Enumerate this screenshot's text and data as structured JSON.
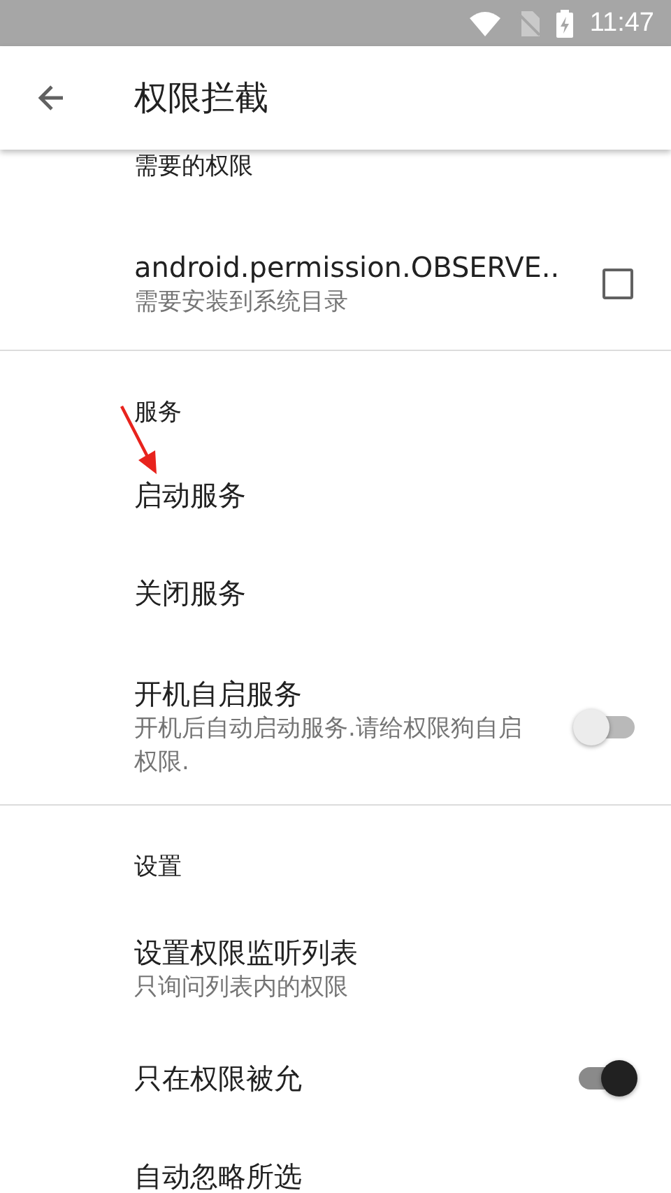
{
  "status_bar": {
    "time": "11:47"
  },
  "toolbar": {
    "title": "权限拦截"
  },
  "sections": [
    {
      "header": "需要的权限",
      "items": [
        {
          "kind": "checkbox",
          "title": "android.permission.OBSERVE..",
          "summary": "需要安装到系统目录",
          "checked": false
        }
      ]
    },
    {
      "header": "服务",
      "items": [
        {
          "kind": "plain",
          "title": "启动服务"
        },
        {
          "kind": "plain",
          "title": "关闭服务"
        },
        {
          "kind": "switch",
          "title": "开机自启服务",
          "summary": "开机后自动启动服务.请给权限狗自启权限.",
          "on": false
        }
      ]
    },
    {
      "header": "设置",
      "items": [
        {
          "kind": "plain",
          "title": "设置权限监听列表",
          "summary": "只询问列表内的权限"
        },
        {
          "kind": "switch",
          "title": "只在权限被允",
          "on": true
        },
        {
          "kind": "plain",
          "title": "自动忽略所选"
        }
      ]
    }
  ]
}
